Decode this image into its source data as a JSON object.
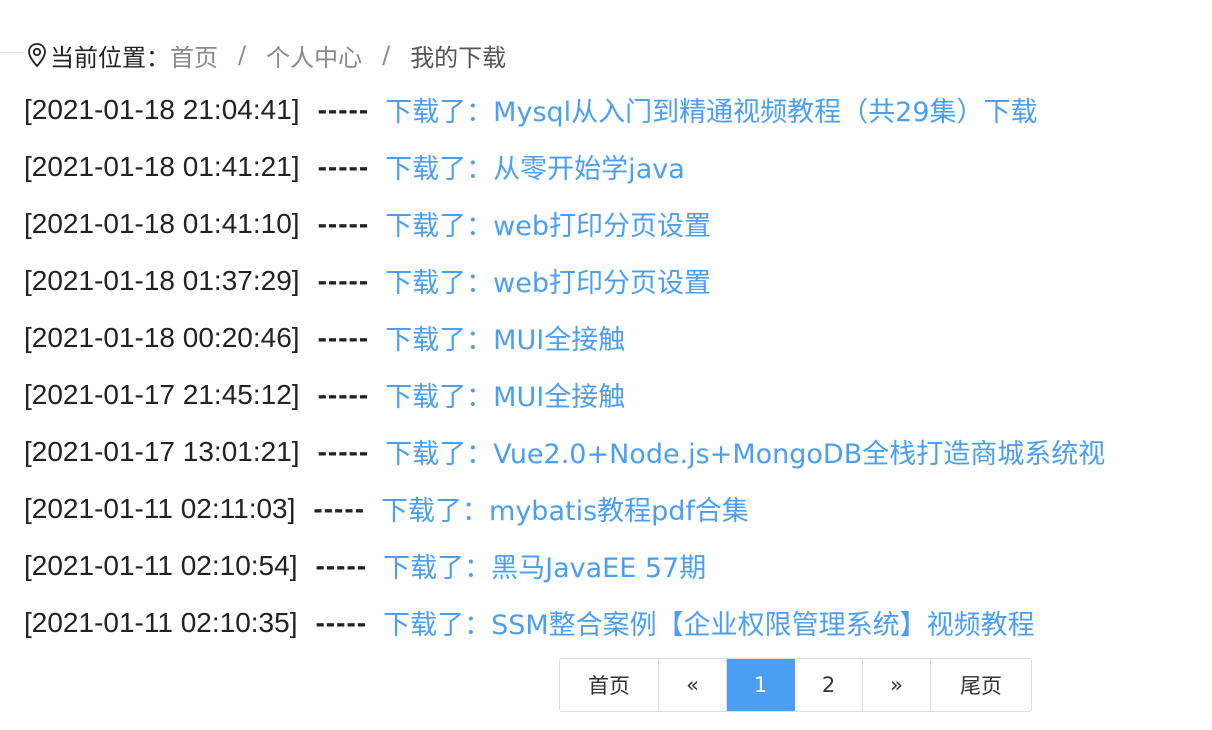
{
  "breadcrumb": {
    "label": "当前位置：",
    "items": [
      "首页",
      "个人中心",
      "我的下载"
    ],
    "separator": "/"
  },
  "records": [
    {
      "time": "[2021-01-18 21:04:41]",
      "dash": "-----",
      "text": "下载了：Mysql从入门到精通视频教程（共29集）下载"
    },
    {
      "time": "[2021-01-18 01:41:21]",
      "dash": "-----",
      "text": "下载了：从零开始学java"
    },
    {
      "time": "[2021-01-18 01:41:10]",
      "dash": "-----",
      "text": "下载了：web打印分页设置"
    },
    {
      "time": "[2021-01-18 01:37:29]",
      "dash": "-----",
      "text": "下载了：web打印分页设置"
    },
    {
      "time": "[2021-01-18 00:20:46]",
      "dash": "-----",
      "text": "下载了：MUI全接触"
    },
    {
      "time": "[2021-01-17 21:45:12]",
      "dash": "-----",
      "text": "下载了：MUI全接触"
    },
    {
      "time": "[2021-01-17 13:01:21]",
      "dash": "-----",
      "text": "下载了：Vue2.0+Node.js+MongoDB全栈打造商城系统视"
    },
    {
      "time": "[2021-01-11 02:11:03]",
      "dash": "-----",
      "text": "下载了：mybatis教程pdf合集"
    },
    {
      "time": "[2021-01-11 02:10:54]",
      "dash": "-----",
      "text": "下载了：黑马JavaEE 57期"
    },
    {
      "time": "[2021-01-11 02:10:35]",
      "dash": "-----",
      "text": "下载了：SSM整合案例【企业权限管理系统】视频教程"
    }
  ],
  "pagination": {
    "first": "首页",
    "prev": "«",
    "pages": [
      "1",
      "2"
    ],
    "active_page": "1",
    "next": "»",
    "last": "尾页"
  },
  "colors": {
    "link": "#4a9ff5",
    "active_page_bg": "#4a9ff5"
  },
  "icons": {
    "breadcrumb": "location-pin-icon"
  }
}
